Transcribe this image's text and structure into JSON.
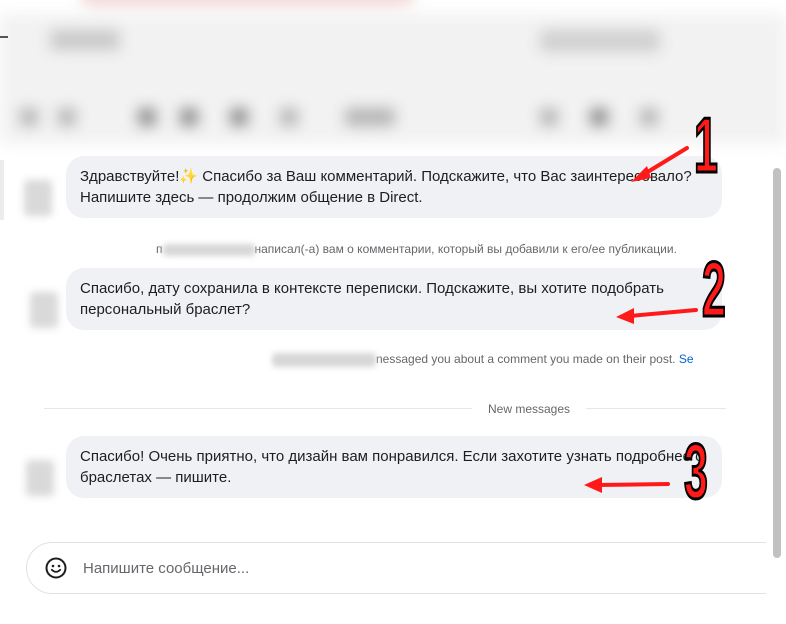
{
  "messages": [
    {
      "text": "Здравствуйте!✨ Спасибо за Ваш комментарий. Подскажите, что Вас заинтересовало? Напишите здесь — продолжим общение в Direct."
    },
    {
      "text": "Спасибо, дату сохранила в контексте переписки. Подскажите, вы хотите подобрать персональный браслет?"
    },
    {
      "text": "Спасибо! Очень приятно, что дизайн вам понравился. Если захотите узнать подробнее о браслетах — пишите."
    }
  ],
  "notices": {
    "ru_suffix": "написал(-а) вам о комментарии, который вы добавили к его/ее публикации.",
    "ru_prefix": "п",
    "en_text": "nessaged you about a comment you made on their post.",
    "en_link": "Se"
  },
  "divider_label": "New messages",
  "composer": {
    "placeholder": "Напишите сообщение...",
    "icon": "smiley-icon"
  },
  "annotations": [
    "1",
    "2",
    "3"
  ],
  "colors": {
    "bubble": "#eff1f4",
    "annotation": "#ff1a1a",
    "link": "#0064d1"
  }
}
